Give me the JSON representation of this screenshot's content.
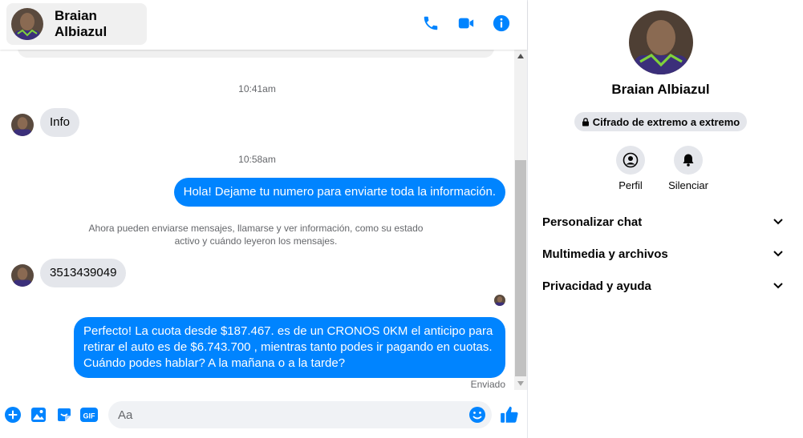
{
  "colors": {
    "accent": "#0084ff",
    "incoming_bubble": "#e4e6eb",
    "muted_text": "#65676b"
  },
  "header": {
    "contact_name": "Braian Albiazul",
    "icons": [
      "phone-icon",
      "video-camera-icon",
      "info-icon"
    ]
  },
  "messages": {
    "timestamps": [
      "10:41am",
      "10:58am"
    ],
    "incoming": [
      "Info",
      "3513439049"
    ],
    "outgoing": [
      "Hola! Dejame tu numero  para enviarte toda la información.",
      "Perfecto! La cuota desde $187.467. es de un CRONOS 0KM el anticipo para retirar el auto es de $6.743.700 , mientras tanto podes ir pagando en cuotas. Cuándo podes hablar? A la mañana o a la tarde?"
    ],
    "system_notice": "Ahora pueden enviarse mensajes, llamarse y ver información, como su estado activo y cuándo leyeron los mensajes.",
    "status": "Enviado"
  },
  "composer": {
    "placeholder": "Aa",
    "icons": [
      "plus-icon",
      "image-icon",
      "sticker-icon",
      "gif-icon",
      "emoji-icon",
      "thumbs-up-icon"
    ],
    "gif_label": "GIF"
  },
  "info_panel": {
    "name": "Braian Albiazul",
    "encryption_badge": "Cifrado de extremo a extremo",
    "actions": [
      {
        "label": "Perfil",
        "icon": "profile-icon"
      },
      {
        "label": "Silenciar",
        "icon": "bell-icon"
      }
    ],
    "sections": [
      {
        "label": "Personalizar chat"
      },
      {
        "label": "Multimedia y archivos"
      },
      {
        "label": "Privacidad y ayuda"
      }
    ]
  }
}
